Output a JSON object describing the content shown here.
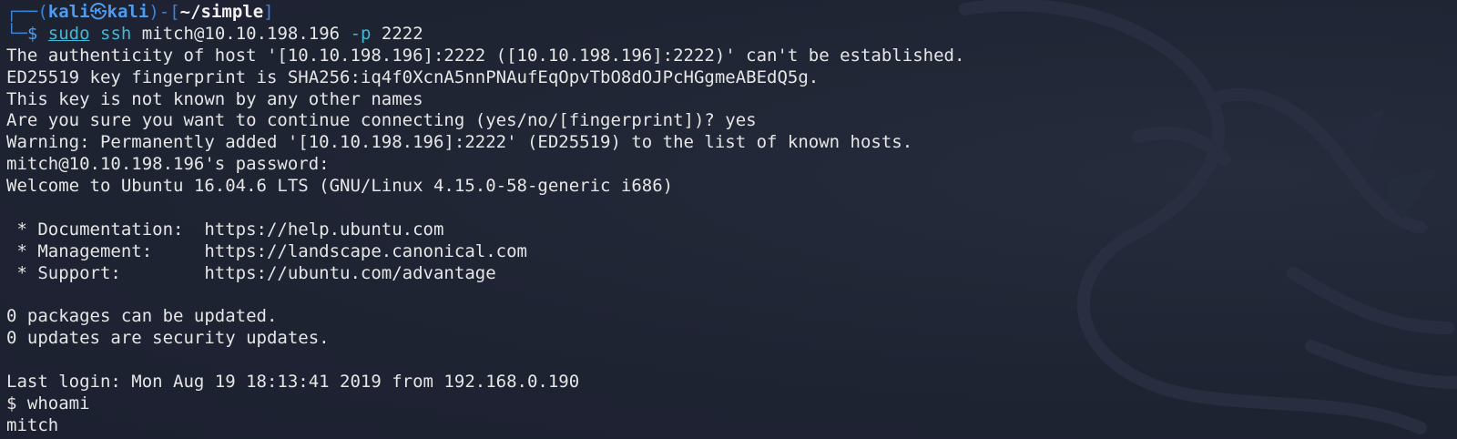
{
  "prompt": {
    "frame_top_left": "┌──(",
    "user": "kali",
    "skull": "㉿",
    "host": "kali",
    "frame_mid": ")-[",
    "path": "~/simple",
    "frame_end": "]",
    "frame_bottom": "└─",
    "dollar": "$ "
  },
  "command": {
    "sudo": "sudo",
    "ssh": "ssh",
    "target": "mitch@10.10.198.196",
    "flag": "-p",
    "port": "2222"
  },
  "output": [
    "The authenticity of host '[10.10.198.196]:2222 ([10.10.198.196]:2222)' can't be established.",
    "ED25519 key fingerprint is SHA256:iq4f0XcnA5nnPNAufEqOpvTbO8dOJPcHGgmeABEdQ5g.",
    "This key is not known by any other names",
    "Are you sure you want to continue connecting (yes/no/[fingerprint])? yes",
    "Warning: Permanently added '[10.10.198.196]:2222' (ED25519) to the list of known hosts.",
    "mitch@10.10.198.196's password: ",
    "Welcome to Ubuntu 16.04.6 LTS (GNU/Linux 4.15.0-58-generic i686)",
    "",
    " * Documentation:  https://help.ubuntu.com",
    " * Management:     https://landscape.canonical.com",
    " * Support:        https://ubuntu.com/advantage",
    "",
    "0 packages can be updated.",
    "0 updates are security updates.",
    "",
    "Last login: Mon Aug 19 18:13:41 2019 from 192.168.0.190",
    "$ whoami",
    "mitch"
  ],
  "colors": {
    "background": "#1f2433",
    "prompt_accent": "#4d9cf0",
    "command_accent": "#3fb9d6",
    "text": "#e6e6e6"
  }
}
